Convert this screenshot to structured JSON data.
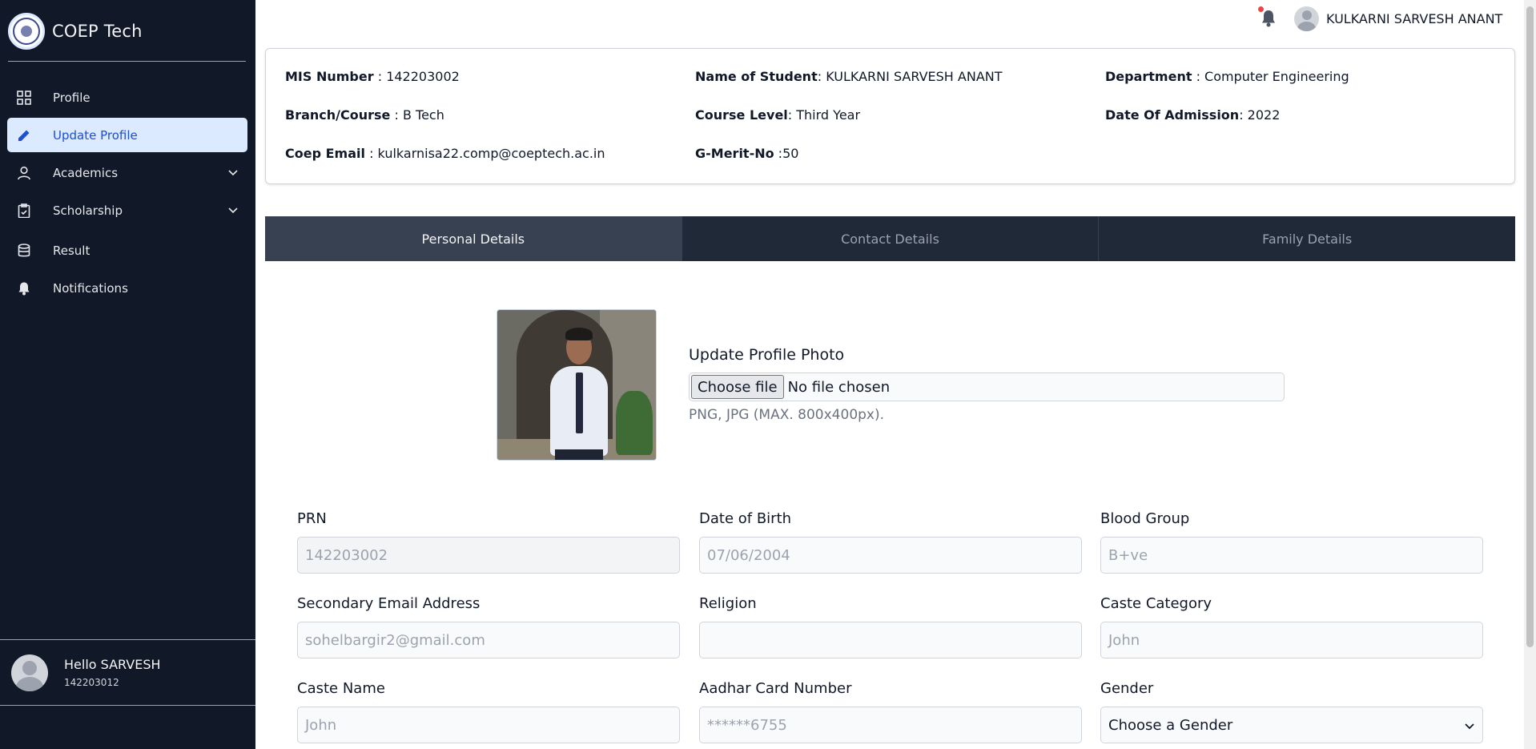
{
  "sidebar": {
    "brand": "COEP Tech",
    "items": [
      {
        "label": "Profile",
        "icon": "grid-icon"
      },
      {
        "label": "Update Profile",
        "icon": "pencil-icon"
      },
      {
        "label": "Academics",
        "icon": "user-icon"
      },
      {
        "label": "Scholarship",
        "icon": "clipboard-icon"
      },
      {
        "label": "Result",
        "icon": "database-icon"
      },
      {
        "label": "Notifications",
        "icon": "bell-icon"
      }
    ],
    "footer": {
      "greeting": "Hello SARVESH",
      "id": "142203012"
    }
  },
  "topbar": {
    "user_name": "KULKARNI SARVESH ANANT"
  },
  "info": {
    "mis_label": "MIS Number",
    "mis_value": "142203002",
    "name_label": "Name of Student",
    "name_value": "KULKARNI SARVESH ANANT",
    "dept_label": "Department",
    "dept_value": "Computer Engineering",
    "branch_label": "Branch/Course",
    "branch_value": "B Tech",
    "level_label": "Course Level",
    "level_value": "Third Year",
    "admission_label": "Date Of Admission",
    "admission_value": "2022",
    "email_label": "Coep Email",
    "email_value": "kulkarnisa22.comp@coeptech.ac.in",
    "merit_label": "G-Merit-No",
    "merit_value": "50"
  },
  "tabs": [
    "Personal Details",
    "Contact Details",
    "Family Details"
  ],
  "upload": {
    "label": "Update Profile Photo",
    "button": "Choose file",
    "status": "No file chosen",
    "hint": "PNG, JPG (MAX. 800x400px)."
  },
  "form": {
    "prn_label": "PRN",
    "prn_value": "142203002",
    "dob_label": "Date of Birth",
    "dob_value": "07/06/2004",
    "blood_label": "Blood Group",
    "blood_value": "B+ve",
    "email2_label": "Secondary Email Address",
    "email2_value": "sohelbargir2@gmail.com",
    "religion_label": "Religion",
    "religion_value": "",
    "caste_cat_label": "Caste Category",
    "caste_cat_value": "John",
    "caste_name_label": "Caste Name",
    "caste_name_value": "John",
    "aadhar_label": "Aadhar Card Number",
    "aadhar_value": "******6755",
    "gender_label": "Gender",
    "gender_value": "Choose a Gender"
  },
  "colors": {
    "sidebar": "#111827",
    "active_bg": "#dbeafe",
    "active_text": "#1d4ed8",
    "tabs": "#1f2937",
    "active_tab": "#374151"
  }
}
